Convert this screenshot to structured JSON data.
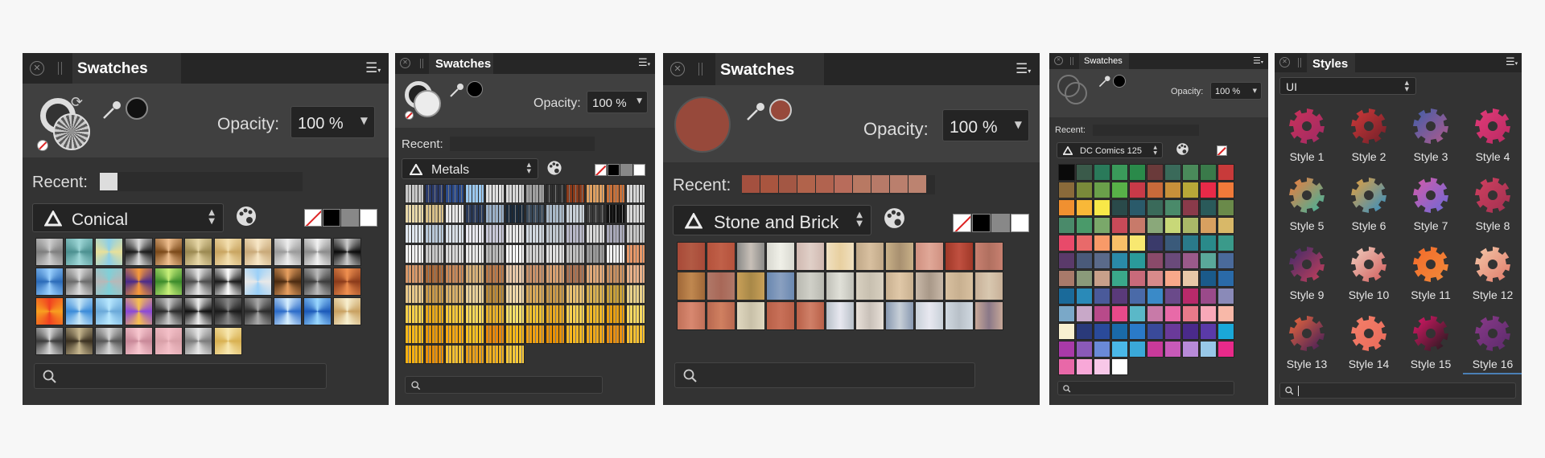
{
  "panels": {
    "p1": {
      "tab_label": "Swatches",
      "opacity_label": "Opacity:",
      "opacity_value": "100 %",
      "recent_label": "Recent:",
      "palette_name": "Conical",
      "recent_colors": [
        "#dddddd"
      ]
    },
    "p2": {
      "tab_label": "Swatches",
      "opacity_label": "Opacity:",
      "opacity_value": "100 %",
      "recent_label": "Recent:",
      "palette_name": "Metals"
    },
    "p3": {
      "tab_label": "Swatches",
      "opacity_label": "Opacity:",
      "opacity_value": "100 %",
      "recent_label": "Recent:",
      "palette_name": "Stone and Brick",
      "fill_color": "#97493b",
      "recent_colors": [
        "#a4503f",
        "#a9553f",
        "#a35744",
        "#b1634b",
        "#b1634f",
        "#b86c5b",
        "#b87963",
        "#b77a68",
        "#ba7f6d",
        "#bc8370"
      ]
    },
    "p4": {
      "tab_label": "Swatches",
      "opacity_label": "Opacity:",
      "opacity_value": "100 %",
      "recent_label": "Recent:",
      "palette_name": "DC Comics 125"
    },
    "p5": {
      "tab_label": "Styles",
      "category": "UI",
      "styles": [
        {
          "name": "Style 1",
          "colors": [
            "#c9325a",
            "#a02a64"
          ]
        },
        {
          "name": "Style 2",
          "colors": [
            "#d03a3a",
            "#6e1e28"
          ]
        },
        {
          "name": "Style 3",
          "colors": [
            "#3e5ea8",
            "#b25a8c"
          ]
        },
        {
          "name": "Style 4",
          "colors": [
            "#e23a78",
            "#b82a62"
          ]
        },
        {
          "name": "Style 5",
          "colors": [
            "#f47a3a",
            "#39b5a0"
          ]
        },
        {
          "name": "Style 6",
          "colors": [
            "#e8a03a",
            "#2e8ec8"
          ]
        },
        {
          "name": "Style 7",
          "colors": [
            "#d65aa8",
            "#6a6ad8"
          ]
        },
        {
          "name": "Style 8",
          "colors": [
            "#d04060",
            "#a03050"
          ]
        },
        {
          "name": "Style 9",
          "colors": [
            "#3a2a6a",
            "#c8405a"
          ]
        },
        {
          "name": "Style 10",
          "colors": [
            "#f0d0c0",
            "#d05a5a"
          ]
        },
        {
          "name": "Style 11",
          "colors": [
            "#f46a2a",
            "#f08a3a"
          ]
        },
        {
          "name": "Style 12",
          "colors": [
            "#f4c8a8",
            "#e07a6a"
          ]
        },
        {
          "name": "Style 13",
          "colors": [
            "#f26a3a",
            "#3a1a5a"
          ]
        },
        {
          "name": "Style 14",
          "colors": [
            "#f4806a",
            "#e86a5a"
          ]
        },
        {
          "name": "Style 15",
          "colors": [
            "#e2186a",
            "#1a1a1a"
          ]
        },
        {
          "name": "Style 16",
          "colors": [
            "#8a3a8a",
            "#5a2a6a"
          ]
        }
      ]
    }
  },
  "icons": [
    "close-icon",
    "grip-icon",
    "panel-menu-icon",
    "color-picker-icon",
    "palette-icon",
    "search-icon",
    "gradient-icon",
    "dropdown-arrow-icon"
  ]
}
